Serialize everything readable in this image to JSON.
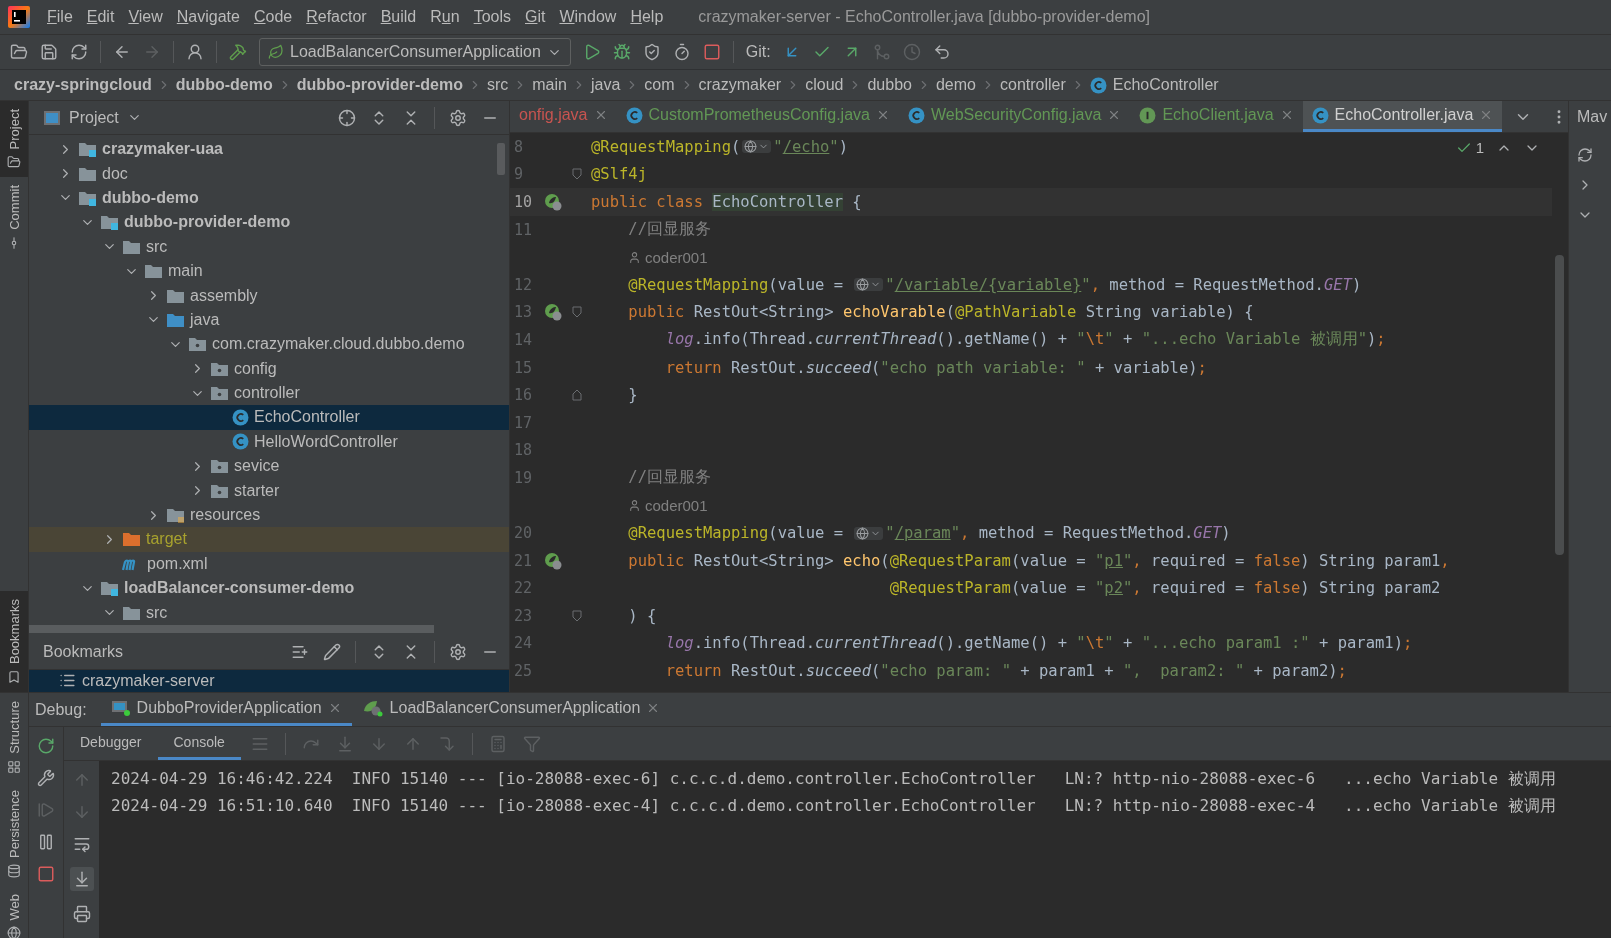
{
  "window": {
    "title": "crazymaker-server - EchoController.java [dubbo-provider-demo]"
  },
  "menu": [
    {
      "key": "F",
      "rest": "ile"
    },
    {
      "key": "E",
      "rest": "dit"
    },
    {
      "key": "V",
      "rest": "iew"
    },
    {
      "key": "N",
      "rest": "avigate"
    },
    {
      "key": "C",
      "rest": "ode"
    },
    {
      "key": "R",
      "rest": "efactor"
    },
    {
      "key": "B",
      "rest": "uild"
    },
    {
      "lead": "R",
      "key": "u",
      "rest": "n"
    },
    {
      "key": "T",
      "rest": "ools"
    },
    {
      "key": "G",
      "rest": "it"
    },
    {
      "key": "W",
      "rest": "indow"
    },
    {
      "key": "H",
      "rest": "elp"
    }
  ],
  "toolbar": {
    "forward_enabled": false,
    "run_configuration": "LoadBalancerConsumerApplication",
    "git_label": "Git:"
  },
  "breadcrumbs": [
    {
      "label": "crazy-springcloud",
      "kind": "module"
    },
    {
      "label": "dubbo-demo",
      "kind": "module"
    },
    {
      "label": "dubbo-provider-demo",
      "kind": "module"
    },
    {
      "label": "src",
      "kind": "dir"
    },
    {
      "label": "main",
      "kind": "dir"
    },
    {
      "label": "java",
      "kind": "dir"
    },
    {
      "label": "com",
      "kind": "dir"
    },
    {
      "label": "crazymaker",
      "kind": "dir"
    },
    {
      "label": "cloud",
      "kind": "dir"
    },
    {
      "label": "dubbo",
      "kind": "dir"
    },
    {
      "label": "demo",
      "kind": "dir"
    },
    {
      "label": "controller",
      "kind": "dir"
    },
    {
      "label": "EchoController",
      "kind": "class"
    }
  ],
  "tool_strip": {
    "top": [
      {
        "label": "Project",
        "selected": true
      },
      {
        "label": "Commit",
        "selected": false
      }
    ],
    "bottom": [
      {
        "label": "Bookmarks",
        "selected": true
      }
    ],
    "debug": [
      {
        "label": "Structure",
        "selected": false
      },
      {
        "label": "Persistence",
        "selected": false
      },
      {
        "label": "Web",
        "selected": false
      }
    ]
  },
  "project_panel": {
    "title": "Project",
    "tree": [
      {
        "label": "crazymaker-uaa",
        "kind": "module",
        "expanded": false,
        "selected": false
      },
      {
        "label": "doc",
        "kind": "folder",
        "expanded": false,
        "selected": false
      },
      {
        "label": "dubbo-demo",
        "kind": "module",
        "expanded": true,
        "selected": false,
        "children": [
          {
            "label": "dubbo-provider-demo",
            "kind": "module",
            "expanded": true,
            "selected": false,
            "children": [
              {
                "label": "src",
                "kind": "folder",
                "expanded": true,
                "selected": false,
                "children": [
                  {
                    "label": "main",
                    "kind": "folder",
                    "expanded": true,
                    "selected": false,
                    "children": [
                      {
                        "label": "assembly",
                        "kind": "folder",
                        "expanded": false,
                        "selected": false
                      },
                      {
                        "label": "java",
                        "kind": "source",
                        "expanded": true,
                        "selected": false,
                        "children": [
                          {
                            "label": "com.crazymaker.cloud.dubbo.demo",
                            "kind": "package",
                            "expanded": true,
                            "selected": false,
                            "children": [
                              {
                                "label": "config",
                                "kind": "package",
                                "expanded": false,
                                "selected": false
                              },
                              {
                                "label": "controller",
                                "kind": "package",
                                "expanded": true,
                                "selected": false,
                                "children": [
                                  {
                                    "label": "EchoController",
                                    "kind": "class",
                                    "selected": true
                                  },
                                  {
                                    "label": "HelloWordController",
                                    "kind": "class",
                                    "selected": false
                                  }
                                ]
                              },
                              {
                                "label": "sevice",
                                "kind": "package",
                                "expanded": false,
                                "selected": false
                              },
                              {
                                "label": "starter",
                                "kind": "package",
                                "expanded": false,
                                "selected": false
                              }
                            ]
                          }
                        ]
                      },
                      {
                        "label": "resources",
                        "kind": "resources",
                        "expanded": false,
                        "selected": false
                      }
                    ]
                  }
                ]
              },
              {
                "label": "target",
                "kind": "excluded",
                "expanded": false,
                "selected": false
              },
              {
                "label": "pom.xml",
                "kind": "maven",
                "selected": false
              }
            ]
          },
          {
            "label": "loadBalancer-consumer-demo",
            "kind": "module",
            "expanded": true,
            "selected": false,
            "children": [
              {
                "label": "src",
                "kind": "folder",
                "expanded": true,
                "selected": false
              }
            ]
          }
        ]
      }
    ]
  },
  "bookmarks_panel": {
    "title": "Bookmarks",
    "items": [
      {
        "label": "crazymaker-server",
        "selected": true
      }
    ]
  },
  "editor": {
    "tabs": [
      {
        "label": "onfig.java",
        "color": "#c75450",
        "selected": false
      },
      {
        "label": "CustomPrometheusConfig.java",
        "kind": "class",
        "color": "#629755",
        "selected": false
      },
      {
        "label": "WebSecurityConfig.java",
        "kind": "class",
        "color": "#629755",
        "selected": false
      },
      {
        "label": "EchoClient.java",
        "kind": "interface",
        "color": "#629755",
        "selected": false
      },
      {
        "label": "EchoController.java",
        "kind": "class",
        "color": "#d0d0d0",
        "selected": true
      }
    ],
    "inspection_count": "1",
    "lines": [
      {
        "kind": "code",
        "number": "8",
        "current": false,
        "bean": false,
        "fold_start": false,
        "fold_end": false,
        "tokens": [
          {
            "kind": "ann",
            "text": "@RequestMapping"
          },
          {
            "kind": "plain",
            "text": "("
          },
          {
            "kind": "globe"
          },
          {
            "kind": "str",
            "text": "\""
          },
          {
            "kind": "url",
            "text": "/echo"
          },
          {
            "kind": "str",
            "text": "\""
          },
          {
            "kind": "plain",
            "text": ")"
          }
        ]
      },
      {
        "kind": "code",
        "number": "9",
        "current": false,
        "bean": false,
        "fold_start": true,
        "fold_end": false,
        "tokens": [
          {
            "kind": "ann",
            "text": "@Slf4j"
          }
        ]
      },
      {
        "kind": "code",
        "number": "10",
        "current": true,
        "bean": true,
        "fold_start": false,
        "fold_end": false,
        "tokens": [
          {
            "kind": "kw",
            "text": "public class "
          },
          {
            "kind": "hl",
            "text": "EchoController"
          },
          {
            "kind": "plain",
            "text": " {"
          }
        ]
      },
      {
        "kind": "code",
        "number": "11",
        "current": false,
        "bean": false,
        "fold_start": false,
        "fold_end": false,
        "tokens": [
          {
            "kind": "cmt",
            "text": "    //回显服务"
          }
        ]
      },
      {
        "kind": "author",
        "author": "coder001"
      },
      {
        "kind": "code",
        "number": "12",
        "current": false,
        "bean": false,
        "fold_start": false,
        "fold_end": false,
        "tokens": [
          {
            "kind": "ann",
            "text": "    @RequestMapping"
          },
          {
            "kind": "plain",
            "text": "(value = "
          },
          {
            "kind": "globe"
          },
          {
            "kind": "str",
            "text": "\""
          },
          {
            "kind": "url",
            "text": "/variable/{variable}"
          },
          {
            "kind": "str",
            "text": "\""
          },
          {
            "kind": "kw",
            "text": ", "
          },
          {
            "kind": "plain",
            "text": "method = RequestMethod."
          },
          {
            "kind": "const",
            "text": "GET"
          },
          {
            "kind": "plain",
            "text": ")"
          }
        ]
      },
      {
        "kind": "code",
        "number": "13",
        "current": false,
        "bean": true,
        "fold_start": true,
        "fold_end": false,
        "tokens": [
          {
            "kind": "kw",
            "text": "    public "
          },
          {
            "kind": "plain",
            "text": "RestOut<String> "
          },
          {
            "kind": "fn",
            "text": "echoVarable"
          },
          {
            "kind": "plain",
            "text": "("
          },
          {
            "kind": "ann",
            "text": "@PathVariable"
          },
          {
            "kind": "plain",
            "text": " String variable) {"
          }
        ]
      },
      {
        "kind": "code",
        "number": "14",
        "current": false,
        "bean": false,
        "fold_start": false,
        "fold_end": false,
        "tokens": [
          {
            "kind": "field",
            "text": "        log"
          },
          {
            "kind": "plain",
            "text": ".info(Thread."
          },
          {
            "kind": "italic",
            "text": "currentThread"
          },
          {
            "kind": "plain",
            "text": "().getName() + "
          },
          {
            "kind": "str",
            "text": "\""
          },
          {
            "kind": "kw",
            "text": "\\t"
          },
          {
            "kind": "str",
            "text": "\""
          },
          {
            "kind": "plain",
            "text": " + "
          },
          {
            "kind": "str",
            "text": "\"...echo Variable 被调用\""
          },
          {
            "kind": "plain",
            "text": ")"
          },
          {
            "kind": "kw",
            "text": ";"
          }
        ]
      },
      {
        "kind": "code",
        "number": "15",
        "current": false,
        "bean": false,
        "fold_start": false,
        "fold_end": false,
        "tokens": [
          {
            "kind": "kw",
            "text": "        return "
          },
          {
            "kind": "plain",
            "text": "RestOut."
          },
          {
            "kind": "italic",
            "text": "succeed"
          },
          {
            "kind": "plain",
            "text": "("
          },
          {
            "kind": "str",
            "text": "\"echo path variable: \""
          },
          {
            "kind": "plain",
            "text": " + variable)"
          },
          {
            "kind": "kw",
            "text": ";"
          }
        ]
      },
      {
        "kind": "code",
        "number": "16",
        "current": false,
        "bean": false,
        "fold_start": false,
        "fold_end": true,
        "tokens": [
          {
            "kind": "plain",
            "text": "    }"
          }
        ]
      },
      {
        "kind": "code",
        "number": "17",
        "current": false,
        "bean": false,
        "fold_start": false,
        "fold_end": false
      },
      {
        "kind": "code",
        "number": "18",
        "current": false,
        "bean": false,
        "fold_start": false,
        "fold_end": false
      },
      {
        "kind": "code",
        "number": "19",
        "current": false,
        "bean": false,
        "fold_start": false,
        "fold_end": false,
        "tokens": [
          {
            "kind": "cmt",
            "text": "    //回显服务"
          }
        ]
      },
      {
        "kind": "author",
        "author": "coder001"
      },
      {
        "kind": "code",
        "number": "20",
        "current": false,
        "bean": false,
        "fold_start": false,
        "fold_end": false,
        "tokens": [
          {
            "kind": "ann",
            "text": "    @RequestMapping"
          },
          {
            "kind": "plain",
            "text": "(value = "
          },
          {
            "kind": "globe"
          },
          {
            "kind": "str",
            "text": "\""
          },
          {
            "kind": "url",
            "text": "/param"
          },
          {
            "kind": "str",
            "text": "\""
          },
          {
            "kind": "kw",
            "text": ", "
          },
          {
            "kind": "plain",
            "text": "method = RequestMethod."
          },
          {
            "kind": "const",
            "text": "GET"
          },
          {
            "kind": "plain",
            "text": ")"
          }
        ]
      },
      {
        "kind": "code",
        "number": "21",
        "current": false,
        "bean": true,
        "fold_start": false,
        "fold_end": false,
        "tokens": [
          {
            "kind": "kw",
            "text": "    public "
          },
          {
            "kind": "plain",
            "text": "RestOut<String> "
          },
          {
            "kind": "fn",
            "text": "echo"
          },
          {
            "kind": "plain",
            "text": "("
          },
          {
            "kind": "ann",
            "text": "@RequestParam"
          },
          {
            "kind": "plain",
            "text": "(value = "
          },
          {
            "kind": "str",
            "text": "\""
          },
          {
            "kind": "url",
            "text": "p1"
          },
          {
            "kind": "str",
            "text": "\""
          },
          {
            "kind": "kw",
            "text": ", "
          },
          {
            "kind": "plain",
            "text": "required = "
          },
          {
            "kind": "kw",
            "text": "false"
          },
          {
            "kind": "plain",
            "text": ") String param1"
          },
          {
            "kind": "kw",
            "text": ","
          }
        ]
      },
      {
        "kind": "code",
        "number": "22",
        "current": false,
        "bean": false,
        "fold_start": false,
        "fold_end": false,
        "tokens": [
          {
            "kind": "ann",
            "text": "                                @RequestParam"
          },
          {
            "kind": "plain",
            "text": "(value = "
          },
          {
            "kind": "str",
            "text": "\""
          },
          {
            "kind": "url",
            "text": "p2"
          },
          {
            "kind": "str",
            "text": "\""
          },
          {
            "kind": "kw",
            "text": ", "
          },
          {
            "kind": "plain",
            "text": "required = "
          },
          {
            "kind": "kw",
            "text": "false"
          },
          {
            "kind": "plain",
            "text": ") String param2"
          }
        ]
      },
      {
        "kind": "code",
        "number": "23",
        "current": false,
        "bean": false,
        "fold_start": true,
        "fold_end": false,
        "tokens": [
          {
            "kind": "plain",
            "text": "    ) {"
          }
        ]
      },
      {
        "kind": "code",
        "number": "24",
        "current": false,
        "bean": false,
        "fold_start": false,
        "fold_end": false,
        "tokens": [
          {
            "kind": "field",
            "text": "        log"
          },
          {
            "kind": "plain",
            "text": ".info(Thread."
          },
          {
            "kind": "italic",
            "text": "currentThread"
          },
          {
            "kind": "plain",
            "text": "().getName() + "
          },
          {
            "kind": "str",
            "text": "\""
          },
          {
            "kind": "kw",
            "text": "\\t"
          },
          {
            "kind": "str",
            "text": "\""
          },
          {
            "kind": "plain",
            "text": " + "
          },
          {
            "kind": "str",
            "text": "\"...echo param1 :\""
          },
          {
            "kind": "plain",
            "text": " + param1)"
          },
          {
            "kind": "kw",
            "text": ";"
          }
        ]
      },
      {
        "kind": "code",
        "number": "25",
        "current": false,
        "bean": false,
        "fold_start": false,
        "fold_end": false,
        "tokens": [
          {
            "kind": "kw",
            "text": "        return "
          },
          {
            "kind": "plain",
            "text": "RestOut."
          },
          {
            "kind": "italic",
            "text": "succeed"
          },
          {
            "kind": "plain",
            "text": "("
          },
          {
            "kind": "str",
            "text": "\"echo param: \""
          },
          {
            "kind": "plain",
            "text": " + param1 + "
          },
          {
            "kind": "str",
            "text": "\",  param2: \""
          },
          {
            "kind": "plain",
            "text": " + param2)"
          },
          {
            "kind": "kw",
            "text": ";"
          }
        ]
      }
    ]
  },
  "right_panel": {
    "title": "Mav"
  },
  "debug": {
    "label": "Debug:",
    "sessions": [
      {
        "label": "DubboProviderApplication",
        "selected": true
      },
      {
        "label": "LoadBalancerConsumerApplication",
        "selected": false
      }
    ],
    "subtabs": [
      {
        "label": "Debugger",
        "selected": false
      },
      {
        "label": "Console",
        "selected": true
      }
    ],
    "console": [
      "2024-04-29 16:46:42.224  INFO 15140 --- [io-28088-exec-6] c.c.c.d.demo.controller.EchoController   LN:? http-nio-28088-exec-6   ...echo Variable 被调用",
      "2024-04-29 16:51:10.640  INFO 15140 --- [io-28088-exec-4] c.c.c.d.demo.controller.EchoController   LN:? http-nio-28088-exec-4   ...echo Variable 被调用"
    ]
  }
}
